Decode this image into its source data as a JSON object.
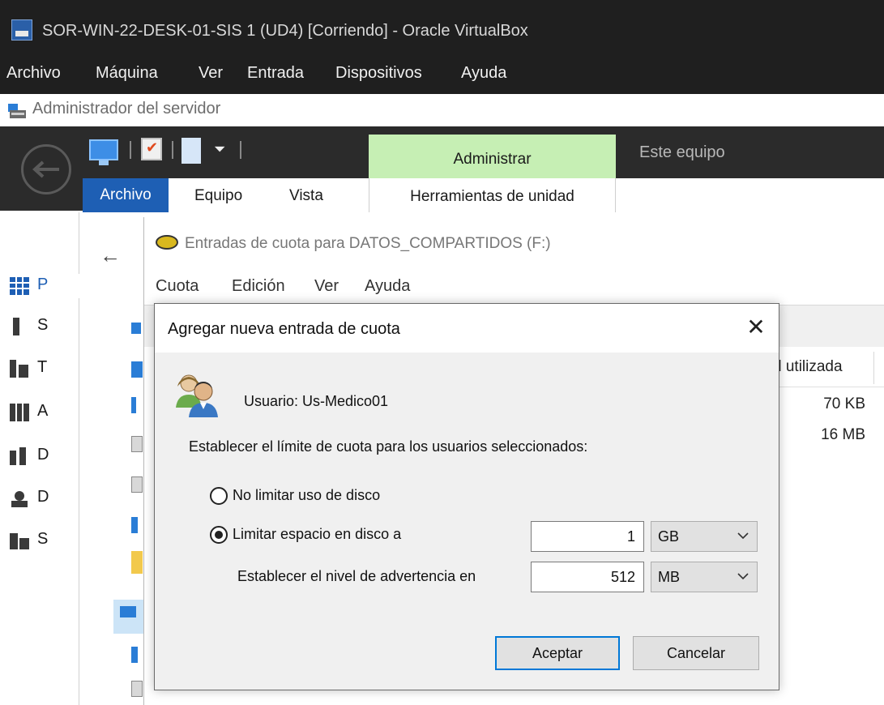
{
  "virtualbox": {
    "title": "SOR-WIN-22-DESK-01-SIS 1 (UD4) [Corriendo] - Oracle VirtualBox",
    "menu": [
      "Archivo",
      "Máquina",
      "Ver",
      "Entrada",
      "Dispositivos",
      "Ayuda"
    ]
  },
  "server_manager": {
    "title": "Administrador del servidor",
    "left_items": [
      {
        "label": "P",
        "icon": "dashboard-grid-icon"
      },
      {
        "label": "S",
        "icon": "server-icon"
      },
      {
        "label": "T",
        "icon": "servers-icon"
      },
      {
        "label": "A",
        "icon": "ad-icon"
      },
      {
        "label": "D",
        "icon": "dns-icon"
      },
      {
        "label": "D",
        "icon": "dhcp-icon"
      },
      {
        "label": "S",
        "icon": "storage-icon"
      }
    ]
  },
  "explorer": {
    "ribbon": {
      "context_tab": "Administrar",
      "location": "Este equipo",
      "tabs": {
        "file": "Archivo",
        "computer": "Equipo",
        "view": "Vista",
        "drive_tools": "Herramientas de unidad"
      }
    }
  },
  "quota_window": {
    "title": "Entradas de cuota para DATOS_COMPARTIDOS (F:)",
    "menu": [
      "Cuota",
      "Edición",
      "Ver",
      "Ayuda"
    ],
    "column_header": "d utilizada",
    "rows": [
      "70 KB",
      "16 MB"
    ]
  },
  "dialog": {
    "title": "Agregar nueva entrada de cuota",
    "user_label": "Usuario: Us-Medico01",
    "set_limit_label": "Establecer el límite de cuota para los usuarios seleccionados:",
    "radio_no_limit": "No limitar uso de disco",
    "radio_limit": "Limitar espacio en disco a",
    "selected_option": "limit",
    "limit_value": "1",
    "limit_unit": "GB",
    "warning_label": "Establecer el nivel de advertencia en",
    "warning_value": "512",
    "warning_unit": "MB",
    "ok": "Aceptar",
    "cancel": "Cancelar"
  },
  "colors": {
    "titlebar": "#1f1f1f",
    "context_tab": "#c6efb4",
    "file_tab": "#1e5fb4",
    "default_button_border": "#0078d7"
  }
}
